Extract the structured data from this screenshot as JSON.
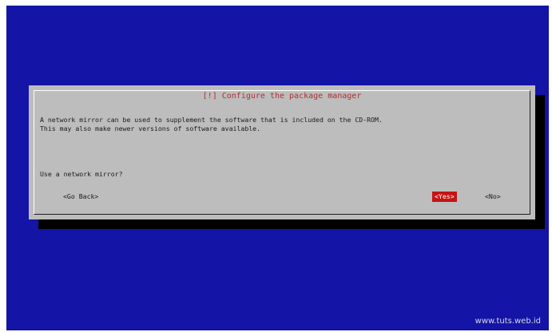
{
  "dialog": {
    "title": "[!] Configure the package manager",
    "message_line_1": "A network mirror can be used to supplement the software that is included on the CD-ROM.",
    "message_line_2": "This may also make newer versions of software available.",
    "question": "Use a network mirror?",
    "buttons": {
      "go_back": "<Go Back>",
      "yes": "<Yes>",
      "no": "<No>"
    }
  },
  "watermark": "www.tuts.web.id",
  "colors": {
    "background": "#1414a6",
    "dialog": "#bdbdbd",
    "title": "#b03030",
    "selected_button": "#c41414"
  }
}
